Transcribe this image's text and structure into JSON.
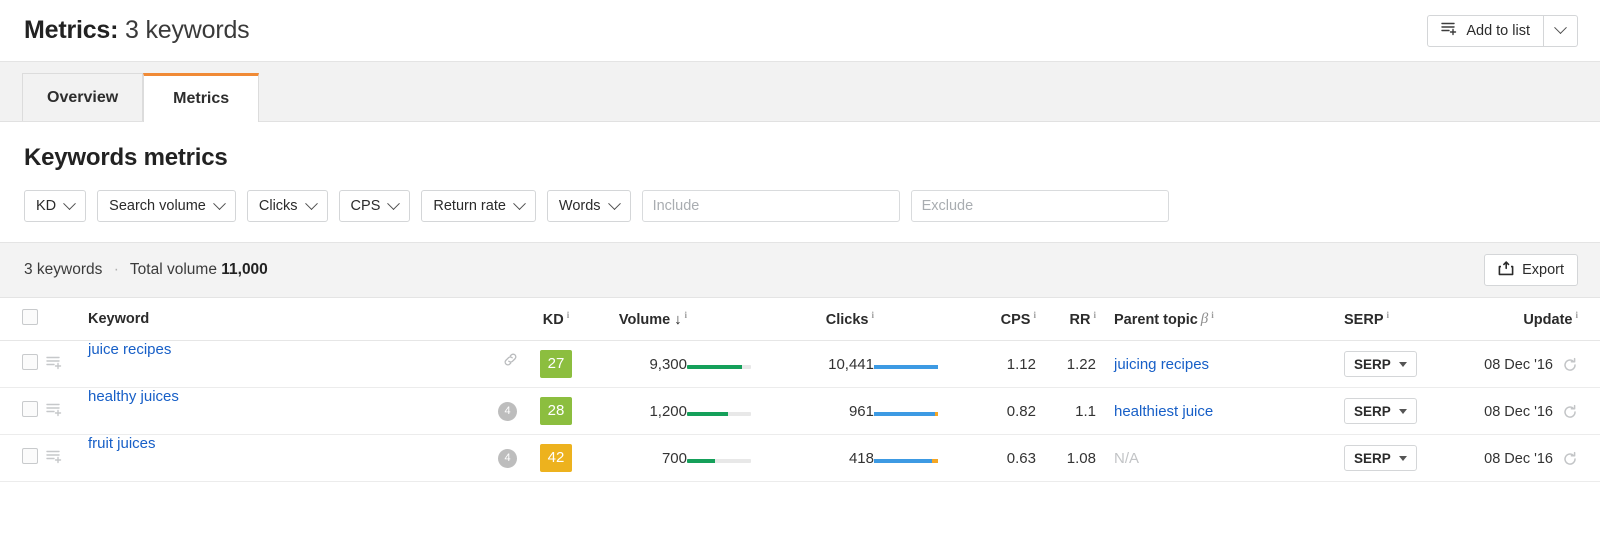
{
  "header": {
    "title_strong": "Metrics:",
    "title_light": "3 keywords",
    "add_to_list_label": "Add to list",
    "add_to_list_icon": "list-plus-icon",
    "dropdown_icon": "chevron-down-icon"
  },
  "tabs": [
    {
      "label": "Overview",
      "active": false
    },
    {
      "label": "Metrics",
      "active": true
    }
  ],
  "accent_color": "#f08a36",
  "section": {
    "title": "Keywords metrics",
    "filters": [
      {
        "label": "KD"
      },
      {
        "label": "Search volume"
      },
      {
        "label": "Clicks"
      },
      {
        "label": "CPS"
      },
      {
        "label": "Return rate"
      },
      {
        "label": "Words"
      }
    ],
    "include_placeholder": "Include",
    "include_value": "",
    "exclude_placeholder": "Exclude",
    "exclude_value": ""
  },
  "summary": {
    "keywords_count": "3 keywords",
    "separator": "·",
    "total_volume_label": "Total volume",
    "total_volume_value": "11,000",
    "export_label": "Export",
    "export_icon": "export-icon"
  },
  "table": {
    "columns": [
      {
        "key": "checkbox",
        "label": ""
      },
      {
        "key": "addicon",
        "label": ""
      },
      {
        "key": "keyword",
        "label": "Keyword",
        "info": false
      },
      {
        "key": "kd",
        "label": "KD",
        "info": true
      },
      {
        "key": "volume",
        "label": "Volume ↓",
        "info": true
      },
      {
        "key": "volumebar",
        "label": ""
      },
      {
        "key": "clicks",
        "label": "Clicks",
        "info": true
      },
      {
        "key": "clicksbar",
        "label": ""
      },
      {
        "key": "cps",
        "label": "CPS",
        "info": true
      },
      {
        "key": "rr",
        "label": "RR",
        "info": true
      },
      {
        "key": "parent",
        "label": "Parent topic",
        "beta": "β",
        "info": true
      },
      {
        "key": "serp",
        "label": "SERP",
        "info": true
      },
      {
        "key": "update",
        "label": "Update",
        "info": true
      }
    ],
    "rows": [
      {
        "keyword": "juice recipes",
        "right_icon": "link-icon",
        "count_badge": null,
        "kd": "27",
        "kd_color": "#8cbe3f",
        "volume": "9,300",
        "volume_pct": 86,
        "clicks": "10,441",
        "clicks_blue_pct": 100,
        "clicks_orange_pct": 0,
        "cps": "1.12",
        "rr": "1.22",
        "parent_topic": "juicing recipes",
        "parent_is_link": true,
        "serp_label": "SERP",
        "update_date": "08 Dec '16"
      },
      {
        "keyword": "healthy juices",
        "right_icon": null,
        "count_badge": "4",
        "kd": "28",
        "kd_color": "#8cbe3f",
        "volume": "1,200",
        "volume_pct": 64,
        "clicks": "961",
        "clicks_blue_pct": 95,
        "clicks_orange_pct": 5,
        "cps": "0.82",
        "rr": "1.1",
        "parent_topic": "healthiest juice",
        "parent_is_link": true,
        "serp_label": "SERP",
        "update_date": "08 Dec '16"
      },
      {
        "keyword": "fruit juices",
        "right_icon": null,
        "count_badge": "4",
        "kd": "42",
        "kd_color": "#edb21e",
        "volume": "700",
        "volume_pct": 44,
        "clicks": "418",
        "clicks_blue_pct": 90,
        "clicks_orange_pct": 10,
        "cps": "0.63",
        "rr": "1.08",
        "parent_topic": "N/A",
        "parent_is_link": false,
        "serp_label": "SERP",
        "update_date": "08 Dec '16"
      }
    ]
  }
}
